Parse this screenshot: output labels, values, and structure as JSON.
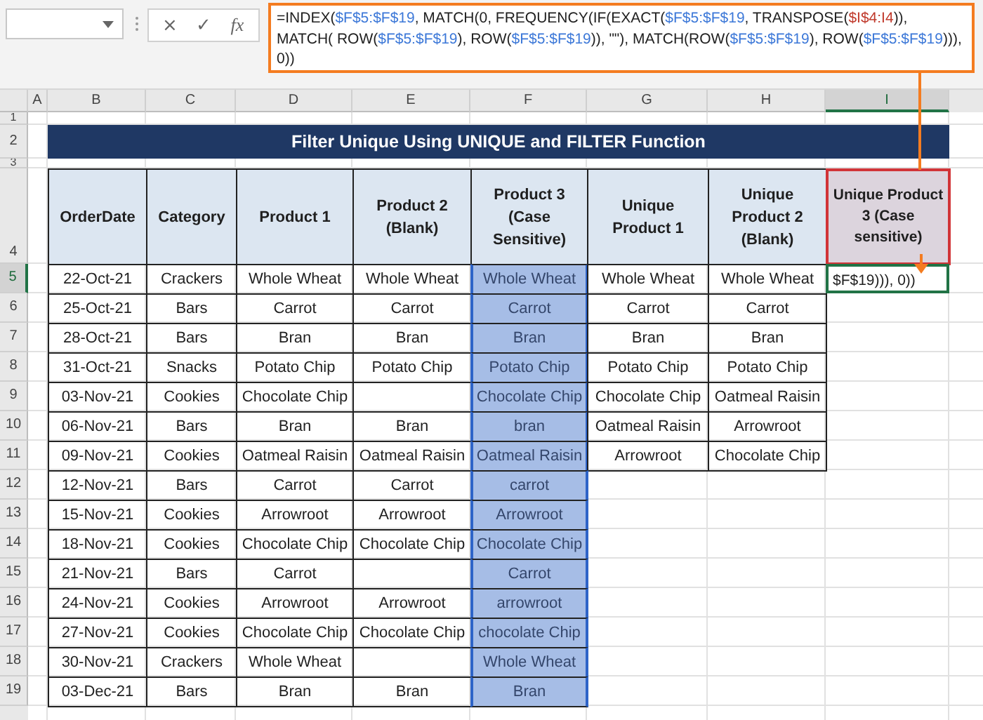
{
  "formula_bar": {
    "buttons": [
      "×",
      "✓",
      "fx"
    ],
    "formula": [
      {
        "text": "=INDEX(",
        "color": "#1f1f1f"
      },
      {
        "text": "$F$5:$F$19",
        "color": "#3c78d8"
      },
      {
        "text": ", MATCH(0, FREQUENCY(IF(EXACT(",
        "color": "#1f1f1f"
      },
      {
        "text": "$F$5:$F$19",
        "color": "#3c78d8"
      },
      {
        "text": ", TRANSPOSE(",
        "color": "#1f1f1f"
      },
      {
        "text": "$I$4:I4",
        "color": "#c0392b"
      },
      {
        "text": ")), MATCH( ROW(",
        "color": "#1f1f1f"
      },
      {
        "text": "$F$5:$F$19",
        "color": "#3c78d8"
      },
      {
        "text": "), ROW(",
        "color": "#1f1f1f"
      },
      {
        "text": "$F$5:$F$19",
        "color": "#3c78d8"
      },
      {
        "text": ")), \"\"), MATCH(ROW(",
        "color": "#1f1f1f"
      },
      {
        "text": "$F$5:$F$19",
        "color": "#3c78d8"
      },
      {
        "text": "), ROW(",
        "color": "#1f1f1f"
      },
      {
        "text": "$F$5:$F$19",
        "color": "#3c78d8"
      },
      {
        "text": "))), 0))",
        "color": "#1f1f1f"
      }
    ]
  },
  "column_headers": [
    {
      "label": "A",
      "selected": false
    },
    {
      "label": "B",
      "selected": false
    },
    {
      "label": "C",
      "selected": false
    },
    {
      "label": "D",
      "selected": false
    },
    {
      "label": "E",
      "selected": false
    },
    {
      "label": "F",
      "selected": false
    },
    {
      "label": "G",
      "selected": false
    },
    {
      "label": "H",
      "selected": false
    },
    {
      "label": "I",
      "selected": true
    }
  ],
  "row_headers": {
    "title_rows": [
      "1",
      "2",
      "3"
    ],
    "header_row": "4"
  },
  "title": "Filter Unique Using UNIQUE and FILTER Function",
  "table": {
    "columns": [
      {
        "heading": "OrderDate",
        "selected": false,
        "referenced": false
      },
      {
        "heading": "Category",
        "selected": false,
        "referenced": false
      },
      {
        "heading": "Product 1",
        "selected": false,
        "referenced": false
      },
      {
        "heading": "Product 2 (Blank)",
        "selected": false,
        "referenced": false
      },
      {
        "heading": "Product 3 (Case Sensitive)",
        "selected": true,
        "referenced": false
      },
      {
        "heading": "Unique Product 1",
        "selected": false,
        "referenced": false
      },
      {
        "heading": "Unique Product 2 (Blank)",
        "selected": false,
        "referenced": false
      },
      {
        "heading": "Unique Product 3 (Case sensitive)",
        "selected": false,
        "referenced": true
      }
    ],
    "rows": [
      {
        "row": "5",
        "selected": true,
        "cells": [
          "22-Oct-21",
          "Crackers",
          "Whole Wheat",
          "Whole Wheat",
          "Whole Wheat",
          "Whole Wheat",
          "Whole Wheat",
          "$F$19))), 0))"
        ]
      },
      {
        "row": "6",
        "selected": false,
        "cells": [
          "25-Oct-21",
          "Bars",
          "Carrot",
          "Carrot",
          "Carrot",
          "Carrot",
          "Carrot",
          null
        ]
      },
      {
        "row": "7",
        "selected": false,
        "cells": [
          "28-Oct-21",
          "Bars",
          "Bran",
          "Bran",
          "Bran",
          "Bran",
          "Bran",
          null
        ]
      },
      {
        "row": "8",
        "selected": false,
        "cells": [
          "31-Oct-21",
          "Snacks",
          "Potato Chip",
          "Potato Chip",
          "Potato Chip",
          "Potato Chip",
          "Potato Chip",
          null
        ]
      },
      {
        "row": "9",
        "selected": false,
        "cells": [
          "03-Nov-21",
          "Cookies",
          "Chocolate Chip",
          null,
          "Chocolate Chip",
          "Chocolate Chip",
          "Oatmeal Raisin",
          null
        ]
      },
      {
        "row": "10",
        "selected": false,
        "cells": [
          "06-Nov-21",
          "Bars",
          "Bran",
          "Bran",
          "bran",
          "Oatmeal Raisin",
          "Arrowroot",
          null
        ]
      },
      {
        "row": "11",
        "selected": false,
        "cells": [
          "09-Nov-21",
          "Cookies",
          "Oatmeal Raisin",
          "Oatmeal Raisin",
          "Oatmeal Raisin",
          "Arrowroot",
          "Chocolate Chip",
          null
        ]
      },
      {
        "row": "12",
        "selected": false,
        "cells": [
          "12-Nov-21",
          "Bars",
          "Carrot",
          "Carrot",
          "carrot",
          null,
          null,
          null
        ]
      },
      {
        "row": "13",
        "selected": false,
        "cells": [
          "15-Nov-21",
          "Cookies",
          "Arrowroot",
          "Arrowroot",
          "Arrowroot",
          null,
          null,
          null
        ]
      },
      {
        "row": "14",
        "selected": false,
        "cells": [
          "18-Nov-21",
          "Cookies",
          "Chocolate Chip",
          "Chocolate Chip",
          "Chocolate Chip",
          null,
          null,
          null
        ]
      },
      {
        "row": "15",
        "selected": false,
        "cells": [
          "21-Nov-21",
          "Bars",
          "Carrot",
          null,
          "Carrot",
          null,
          null,
          null
        ]
      },
      {
        "row": "16",
        "selected": false,
        "cells": [
          "24-Nov-21",
          "Cookies",
          "Arrowroot",
          "Arrowroot",
          "arrowroot",
          null,
          null,
          null
        ]
      },
      {
        "row": "17",
        "selected": false,
        "cells": [
          "27-Nov-21",
          "Cookies",
          "Chocolate Chip",
          "Chocolate Chip",
          "chocolate Chip",
          null,
          null,
          null
        ]
      },
      {
        "row": "18",
        "selected": false,
        "cells": [
          "30-Nov-21",
          "Crackers",
          "Whole Wheat",
          null,
          "Whole Wheat",
          null,
          null,
          null
        ]
      },
      {
        "row": "19",
        "selected": false,
        "cells": [
          "03-Dec-21",
          "Bars",
          "Bran",
          "Bran",
          "Bran",
          null,
          null,
          null
        ]
      }
    ]
  }
}
